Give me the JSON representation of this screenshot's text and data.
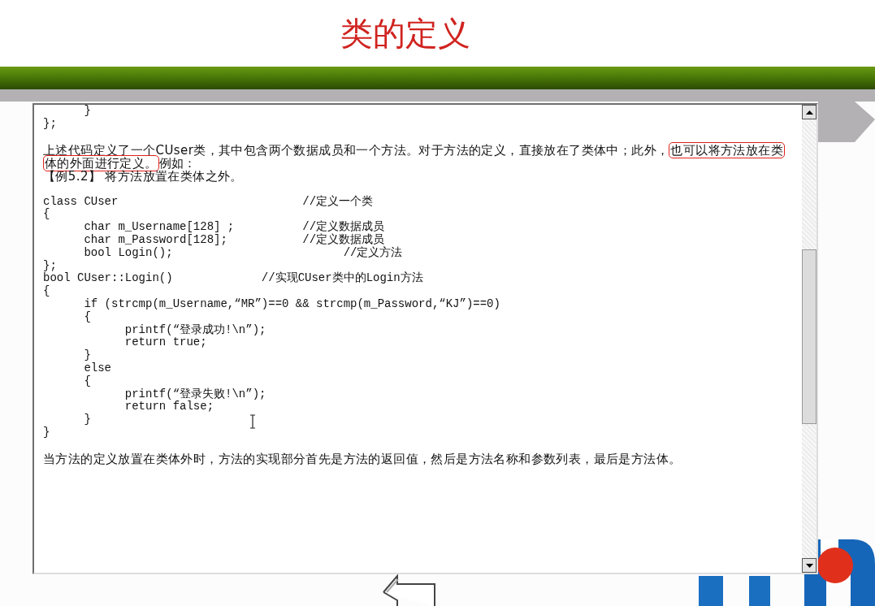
{
  "title": "类的定义",
  "content": [
    {
      "kind": "code",
      "lines": [
        "      }",
        "};"
      ]
    },
    {
      "kind": "paragraph",
      "text": "上述代码定义了一个CUser类，其中包含两个数据成员和一个方法。对于方法的定义，直接放在了类体中；此外，",
      "highlight": "也可以将方法放在类体的外面进行定义。",
      "after": "例如："
    },
    {
      "kind": "label",
      "text": "【例5.2】 将方法放置在类体之外。"
    },
    {
      "kind": "code",
      "lines": [
        "class CUser                           //定义一个类",
        "{",
        "      char m_Username[128] ;          //定义数据成员",
        "      char m_Password[128];           //定义数据成员",
        "      bool Login();                         //定义方法",
        "};",
        "bool CUser::Login()             //实现CUser类中的Login方法",
        "{",
        "      if (strcmp(m_Username,“MR”)==0 && strcmp(m_Password,“KJ”)==0)",
        "      {",
        "            printf(“登录成功!\\n”);",
        "            return true;",
        "      }",
        "      else",
        "      {",
        "            printf(“登录失败!\\n”);",
        "            return false;",
        "      }",
        "}"
      ]
    },
    {
      "kind": "paragraph",
      "text": "当方法的定义放置在类体外时，方法的实现部分首先是方法的返回值，然后是方法名称和参数列表，最后是方法体。"
    }
  ]
}
